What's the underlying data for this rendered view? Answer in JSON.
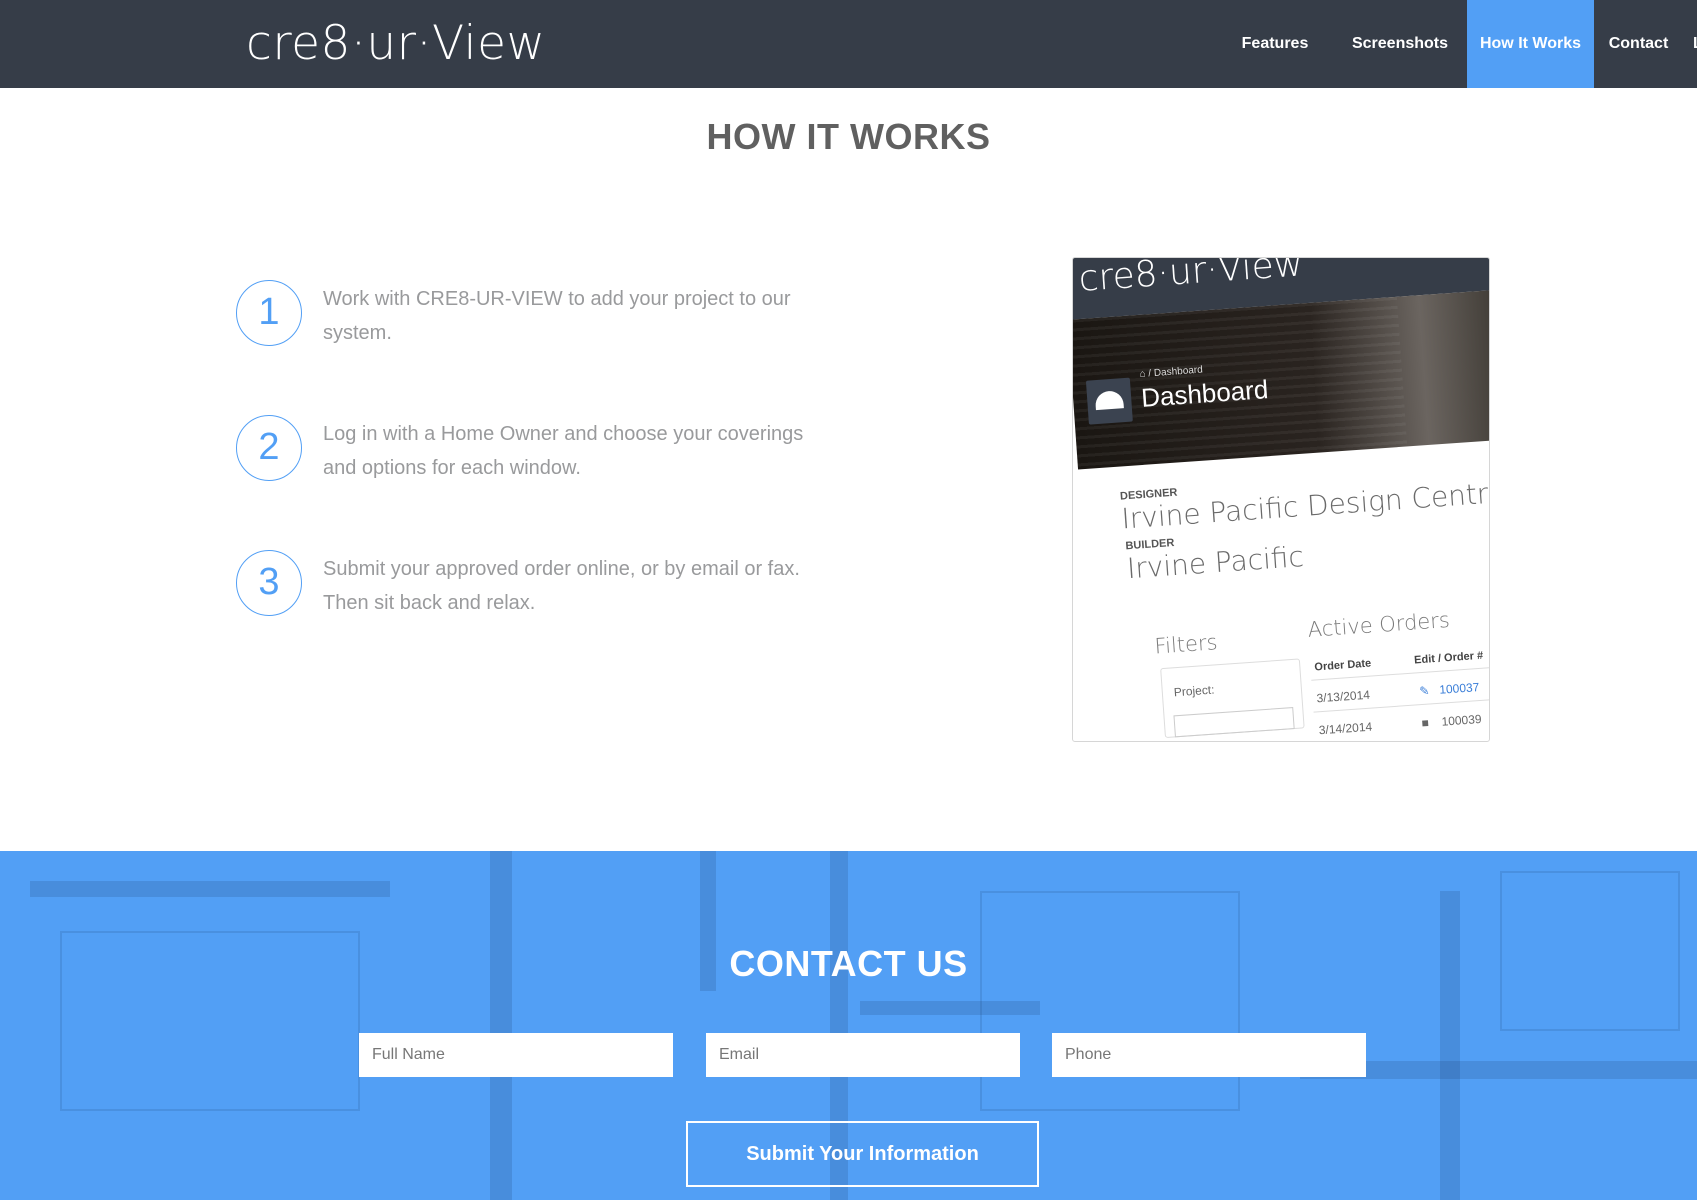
{
  "brand": {
    "logo_text": "cre8·ur·View"
  },
  "nav": {
    "items": [
      {
        "label": "Features"
      },
      {
        "label": "Screenshots"
      },
      {
        "label": "How It Works"
      },
      {
        "label": "Contact"
      },
      {
        "label": "Log In"
      }
    ],
    "active": "How It Works",
    "active_color": "#529ff5",
    "bar_color": "#363d48"
  },
  "how_it_works": {
    "title": "HOW IT WORKS",
    "steps": [
      {
        "number": "1",
        "line1": "Work with CRE8-UR-VIEW to add your project to our",
        "line2": "system."
      },
      {
        "number": "2",
        "line1": "Log in with a Home Owner and choose your coverings",
        "line2": "and options for each window."
      },
      {
        "number": "3",
        "line1": "Submit your approved order online, or by email or fax.",
        "line2": "Then sit back and relax."
      }
    ]
  },
  "screenshot": {
    "logo": "cre8·ur·View",
    "breadcrumb": "⌂ / Dashboard",
    "page_title": "Dashboard",
    "designer_label": "DESIGNER",
    "designer": "Irvine Pacific Design Central",
    "builder_label": "BUILDER",
    "builder": "Irvine Pacific",
    "filters_title": "Filters",
    "filter_project_label": "Project:",
    "orders_title": "Active Orders",
    "col_date": "Order Date",
    "col_order": "Edit / Order #",
    "rows": [
      {
        "date": "3/13/2014",
        "order": "100037",
        "icon": "pencil-icon"
      },
      {
        "date": "3/14/2014",
        "order": "100039",
        "icon": "lock-icon"
      }
    ]
  },
  "contact": {
    "title": "CONTACT US",
    "full_name_placeholder": "Full Name",
    "email_placeholder": "Email",
    "phone_placeholder": "Phone",
    "submit_label": "Submit Your Information",
    "bg_color": "#529ff5"
  }
}
